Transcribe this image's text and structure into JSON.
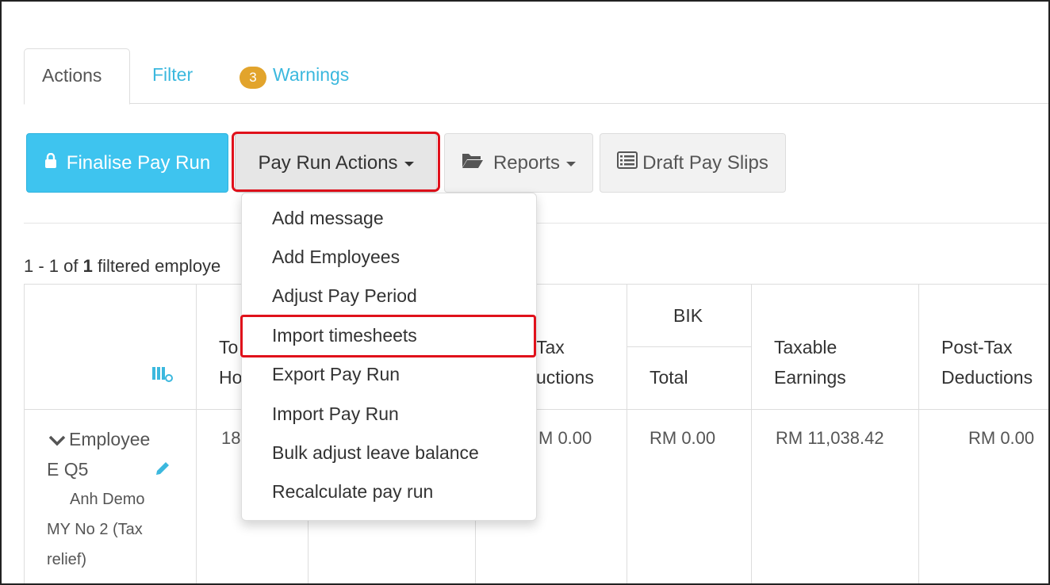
{
  "tabs": {
    "actions": "Actions",
    "filter": "Filter",
    "warnings_count": "3",
    "warnings": "Warnings"
  },
  "toolbar": {
    "finalise": "Finalise Pay Run",
    "pay_run_actions": "Pay Run Actions",
    "reports": "Reports",
    "draft_pay_slips": "Draft Pay Slips"
  },
  "summary": {
    "range": "1 - 1 of",
    "count": "1",
    "suffix": "filtered employe"
  },
  "menu": {
    "items": [
      "Add message",
      "Add Employees",
      "Adjust Pay Period",
      "Import timesheets",
      "Export Pay Run",
      "Import Pay Run",
      "Bulk adjust leave balance",
      "Recalculate pay run"
    ]
  },
  "table": {
    "headers": {
      "total_hours_line1": "To",
      "total_hours_line2": "Ho",
      "tax_line1": "Tax",
      "tax_line2": "uctions",
      "bik": "BIK",
      "bik_total": "Total",
      "taxable_line1": "Taxable",
      "taxable_line2": "Earnings",
      "post_tax_line1": "Post-Tax",
      "post_tax_line2": "Deductions"
    },
    "row": {
      "employee_line1": "Employee",
      "employee_line2": "E Q5",
      "employer_line1": "Anh Demo",
      "employer_line2": "MY No 2 (Tax",
      "employer_line3": "relief)",
      "hours": "18",
      "tax": "M 0.00",
      "bik_total": "RM 0.00",
      "taxable": "RM 11,038.42",
      "post_tax": "RM 0.00"
    }
  },
  "colors": {
    "accent": "#3ec4ef",
    "link": "#3bb8de",
    "badge": "#e2a42c",
    "highlight": "#e0111b"
  }
}
